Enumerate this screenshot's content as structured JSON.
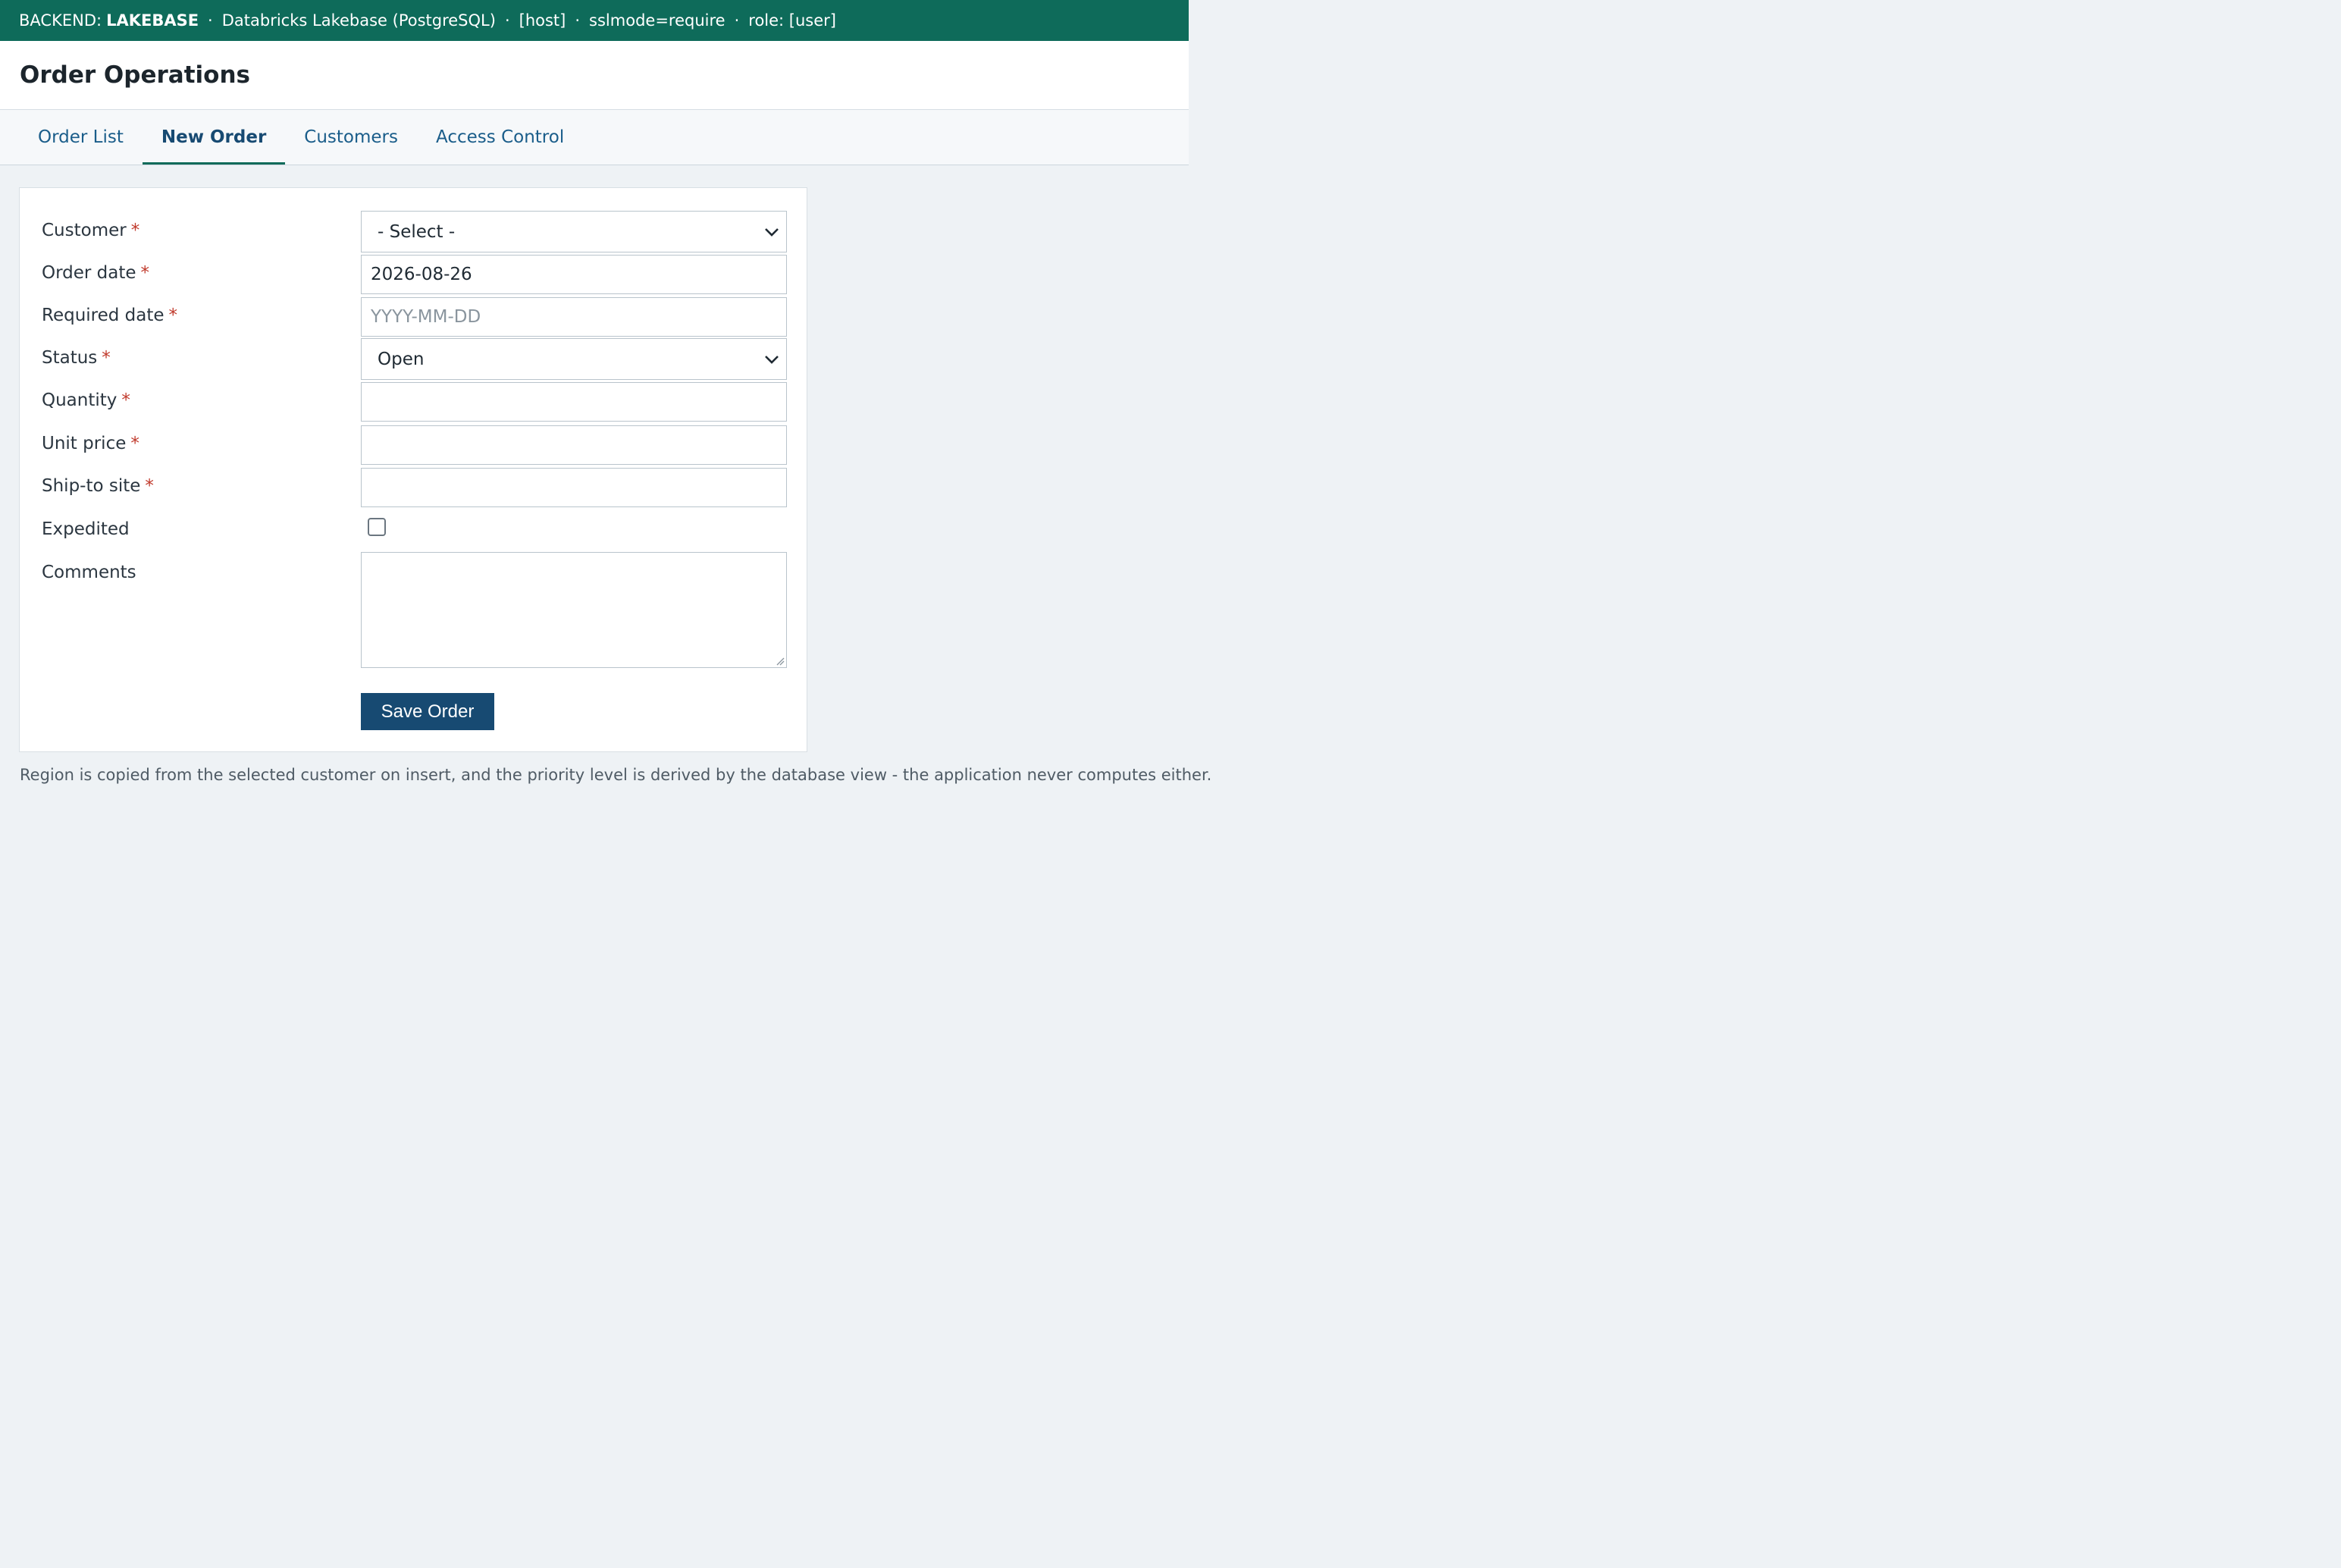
{
  "backend_bar": {
    "label": "BACKEND:",
    "backend": "LAKEBASE",
    "separator": "·",
    "engine": "Databricks Lakebase (PostgreSQL)",
    "host": "[host]",
    "ssl": "sslmode=require",
    "role": "role: [user]"
  },
  "header": {
    "title": "Order Operations"
  },
  "tabs": [
    {
      "label": "Order List",
      "active": false
    },
    {
      "label": "New Order",
      "active": true
    },
    {
      "label": "Customers",
      "active": false
    },
    {
      "label": "Access Control",
      "active": false
    }
  ],
  "form": {
    "required_marker": "*",
    "customer": {
      "label": "Customer",
      "value": "- Select -"
    },
    "order_date": {
      "label": "Order date",
      "value": "2026-08-26"
    },
    "required_date": {
      "label": "Required date",
      "placeholder": "YYYY-MM-DD"
    },
    "status": {
      "label": "Status",
      "value": "Open"
    },
    "quantity": {
      "label": "Quantity",
      "value": ""
    },
    "unit_price": {
      "label": "Unit price",
      "value": ""
    },
    "ship_to_site": {
      "label": "Ship-to site",
      "value": ""
    },
    "expedited": {
      "label": "Expedited",
      "checked": false
    },
    "comments": {
      "label": "Comments",
      "value": ""
    },
    "save_label": "Save Order"
  },
  "footnote": "Region is copied from the selected customer on insert, and the priority level is derived by the database view - the application never computes either.",
  "colors": {
    "topbar": "#0e6b5a",
    "accent_tab": "#0e6b5a",
    "button": "#174a72",
    "required": "#c0392b"
  }
}
